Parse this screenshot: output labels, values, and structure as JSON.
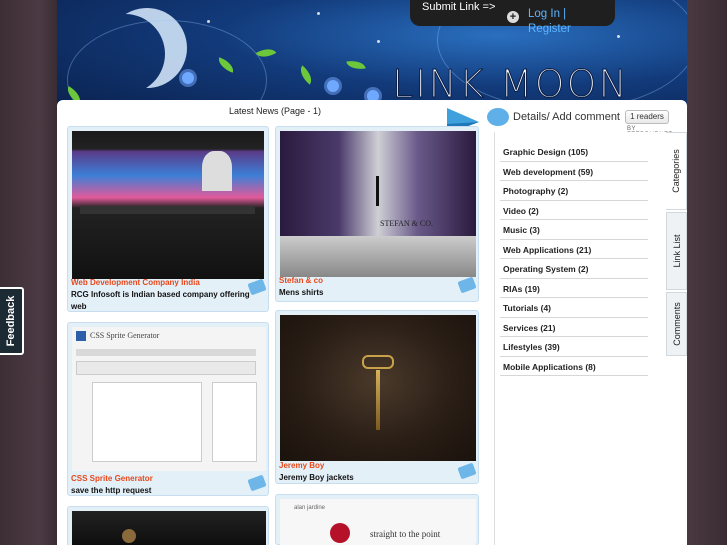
{
  "header": {
    "submit_link": "Submit Link =>",
    "login_register": "Log In | Register",
    "logo_text": "LINK MOON",
    "plus_symbol": "+"
  },
  "main": {
    "latest_news": "Latest News (Page - 1)",
    "details_label": "Details/ Add comment",
    "feed": {
      "count": "1 readers",
      "by": "BY FEEDBURNER"
    }
  },
  "posts": [
    {
      "title": "Web Development Company India",
      "desc": "RCG Infosoft is Indian based company offering web"
    },
    {
      "title": "Stefan & co",
      "desc": "Mens shirts"
    },
    {
      "title": "CSS Sprite Generator",
      "desc": "save the http request"
    },
    {
      "title": "Jeremy Boy",
      "desc": "Jeremy Boy jackets"
    }
  ],
  "thumb_texts": {
    "css_sprite_heading": "CSS Sprite Generator",
    "stefan_brand": "STEFAN & CO.",
    "alan_tagline": "straight to the point",
    "alan_logo": "alan jardine"
  },
  "sidebar": {
    "categories": [
      "Graphic Design (105)",
      "Web development (59)",
      "Photography (2)",
      "Video (2)",
      "Music (3)",
      "Web Applications (21)",
      "Operating System (2)",
      "RIAs (19)",
      "Tutorials (4)",
      "Services (21)",
      "Lifestyles (39)",
      "Mobile Applications (8)"
    ],
    "tabs": [
      "Categories",
      "Link List",
      "Comments"
    ]
  },
  "feedback_label": "Feedback",
  "colors": {
    "accent_blue": "#5fb4ff",
    "title_orange": "#e8481c",
    "post_bg": "#e3f0f8"
  }
}
